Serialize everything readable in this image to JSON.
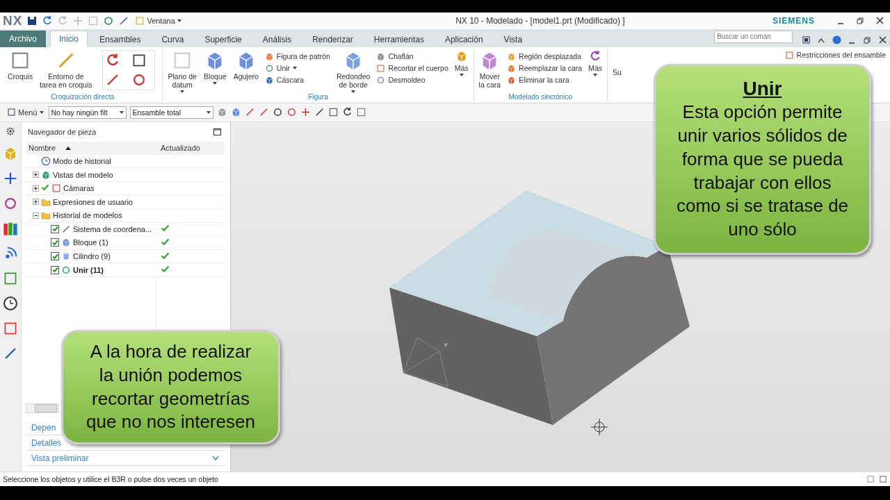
{
  "title_bar": {
    "logo": "NX",
    "window_menu": "Ventana",
    "title": "NX 10 - Modelado - [model1.prt (Modificado) ]",
    "brand": "SIEMENS"
  },
  "tabs": [
    {
      "label": "Archivo",
      "kind": "file",
      "selected": false
    },
    {
      "label": "Inicio",
      "kind": "tab",
      "selected": true
    },
    {
      "label": "Ensambles",
      "kind": "tab",
      "selected": false
    },
    {
      "label": "Curva",
      "kind": "tab",
      "selected": false
    },
    {
      "label": "Superficie",
      "kind": "tab",
      "selected": false
    },
    {
      "label": "Análisis",
      "kind": "tab",
      "selected": false
    },
    {
      "label": "Renderizar",
      "kind": "tab",
      "selected": false
    },
    {
      "label": "Herramientas",
      "kind": "tab",
      "selected": false
    },
    {
      "label": "Aplicación",
      "kind": "tab",
      "selected": false
    },
    {
      "label": "Vista",
      "kind": "tab",
      "selected": false
    }
  ],
  "search": {
    "placeholder": "Buscar un coman"
  },
  "ribbon": {
    "sketch": {
      "label": "Croquización directa",
      "buttons": [
        {
          "label": "Croquis"
        },
        {
          "label": "Entorno de\ntarea en croquis"
        }
      ]
    },
    "feature": {
      "label": "Figura",
      "large": [
        {
          "label": "Plano de\ndatum",
          "dropdown": true
        },
        {
          "label": "Bloque",
          "dropdown": true
        },
        {
          "label": "Agujero",
          "dropdown": false
        }
      ],
      "small": [
        {
          "label": "Figura de patrón",
          "dropdown": false
        },
        {
          "label": "Unir",
          "dropdown": true
        },
        {
          "label": "Cáscara",
          "dropdown": false
        }
      ],
      "large2": {
        "label": "Redondeo\nde borde",
        "dropdown": true
      },
      "small2": [
        {
          "label": "Chaflán",
          "dropdown": false
        },
        {
          "label": "Recortar el cuerpo",
          "dropdown": false
        },
        {
          "label": "Desmoldeo",
          "dropdown": false
        }
      ],
      "more": "Más"
    },
    "sync": {
      "label": "Modelado sincrónico",
      "large": {
        "label": "Mover\nla cara"
      },
      "small": [
        {
          "label": "Región desplazada"
        },
        {
          "label": "Reemplazar la cara"
        },
        {
          "label": "Eliminar la cara"
        }
      ],
      "more": "Más"
    },
    "surface_cut": "Su",
    "assembly": "Restricciones del ensamble"
  },
  "toolbar": {
    "menu": "Menú",
    "filter": "No hay ningún filt",
    "scope": "Ensamble total"
  },
  "navigator": {
    "title": "Navegador de pieza",
    "columns": [
      "Nombre",
      "Actualizado"
    ],
    "tree": [
      {
        "label": "Modo de historial",
        "kind": "history-mode"
      },
      {
        "label": "Vistas del modelo",
        "kind": "views",
        "expanded": false
      },
      {
        "label": "Cámaras",
        "kind": "cameras",
        "expanded": false,
        "shown": true
      },
      {
        "label": "Expresiones de usuario",
        "kind": "folder",
        "expanded": false
      },
      {
        "label": "Historial de modelos",
        "kind": "folder",
        "expanded": true,
        "children": [
          {
            "label": "Sistema de coordena...",
            "kind": "csys",
            "checked": true,
            "updated": true,
            "current": false
          },
          {
            "label": "Bloque (1)",
            "kind": "block",
            "checked": true,
            "updated": true,
            "current": false
          },
          {
            "label": "Cilindro (9)",
            "kind": "cylinder",
            "checked": true,
            "updated": true,
            "current": false
          },
          {
            "label": "Unir (11)",
            "kind": "unite",
            "checked": true,
            "updated": true,
            "current": true
          }
        ]
      }
    ],
    "panels": [
      {
        "label": "Depen"
      },
      {
        "label": "Detalles"
      },
      {
        "label": "Vista preliminar",
        "expanded": false
      }
    ]
  },
  "viewport": {
    "triad_label": "Y"
  },
  "callouts": [
    {
      "title": "Unir",
      "text": "Esta opción permite\nunir varios sólidos de\nforma que se pueda\ntrabajar con ellos\ncomo si se tratase de\nuno sólo"
    },
    {
      "text": "A la hora de realizar\nla unión podemos\nrecortar geometrías\nque no nos interesen"
    }
  ],
  "status_bar": {
    "message": "Seleccione los objetos y utilice el B3R o pulse dos veces un objeto"
  }
}
